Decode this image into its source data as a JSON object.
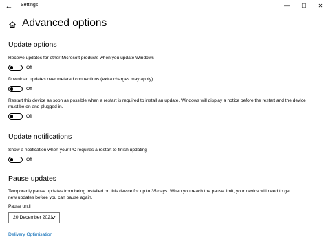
{
  "window": {
    "title": "Settings",
    "back_glyph": "←",
    "minimize_glyph": "—",
    "maximize_glyph": "☐",
    "close_glyph": "✕"
  },
  "page": {
    "title": "Advanced options",
    "icon": "home-icon"
  },
  "update_options": {
    "heading": "Update options",
    "settings": [
      {
        "label": "Receive updates for other Microsoft products when you update Windows",
        "state": "Off"
      },
      {
        "label": "Download updates over metered connections (extra charges may apply)",
        "state": "Off"
      },
      {
        "label": "Restart this device as soon as possible when a restart is required to install an update. Windows will display a notice before the restart and the device must be on and plugged in.",
        "state": "Off"
      }
    ]
  },
  "update_notifications": {
    "heading": "Update notifications",
    "settings": [
      {
        "label": "Show a notification when your PC requires a restart to finish updating",
        "state": "Off"
      }
    ]
  },
  "pause_updates": {
    "heading": "Pause updates",
    "description": "Temporarily pause updates from being installed on this device for up to 35 days. When you reach the pause limit, your device will need to get new updates before you can pause again.",
    "pause_until_label": "Pause until",
    "pause_until_value": "20 December 2021"
  },
  "links": {
    "delivery_optimisation": "Delivery Optimisation"
  },
  "colors": {
    "link": "#0066b4",
    "toggle_off": "#000000"
  }
}
